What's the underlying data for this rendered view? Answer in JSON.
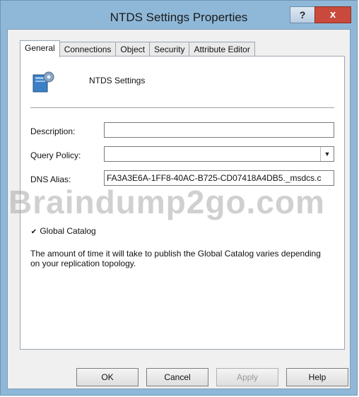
{
  "window": {
    "title": "NTDS Settings Properties",
    "help_label": "?",
    "close_label": "x"
  },
  "tabs": [
    {
      "label": "General"
    },
    {
      "label": "Connections"
    },
    {
      "label": "Object"
    },
    {
      "label": "Security"
    },
    {
      "label": "Attribute Editor"
    }
  ],
  "general": {
    "object_name": "NTDS Settings",
    "description_label": "Description:",
    "description_value": "",
    "query_policy_label": "Query Policy:",
    "query_policy_value": "",
    "dns_alias_label": "DNS Alias:",
    "dns_alias_value": "FA3A3E6A-1FF8-40AC-B725-CD07418A4DB5._msdcs.c",
    "global_catalog_label": "Global Catalog",
    "global_catalog_checked": true,
    "global_catalog_note": "The amount of time it will take to publish the Global Catalog varies depending on your replication topology."
  },
  "watermark": "Braindump2go.com",
  "buttons": {
    "ok": "OK",
    "cancel": "Cancel",
    "apply": "Apply",
    "help": "Help"
  },
  "icons": {
    "object": "ntds-settings-icon",
    "dropdown": "chevron-down-icon",
    "check": "check-icon"
  },
  "colors": {
    "titlebar": "#8fb8d8",
    "close_button": "#c94a3c"
  }
}
